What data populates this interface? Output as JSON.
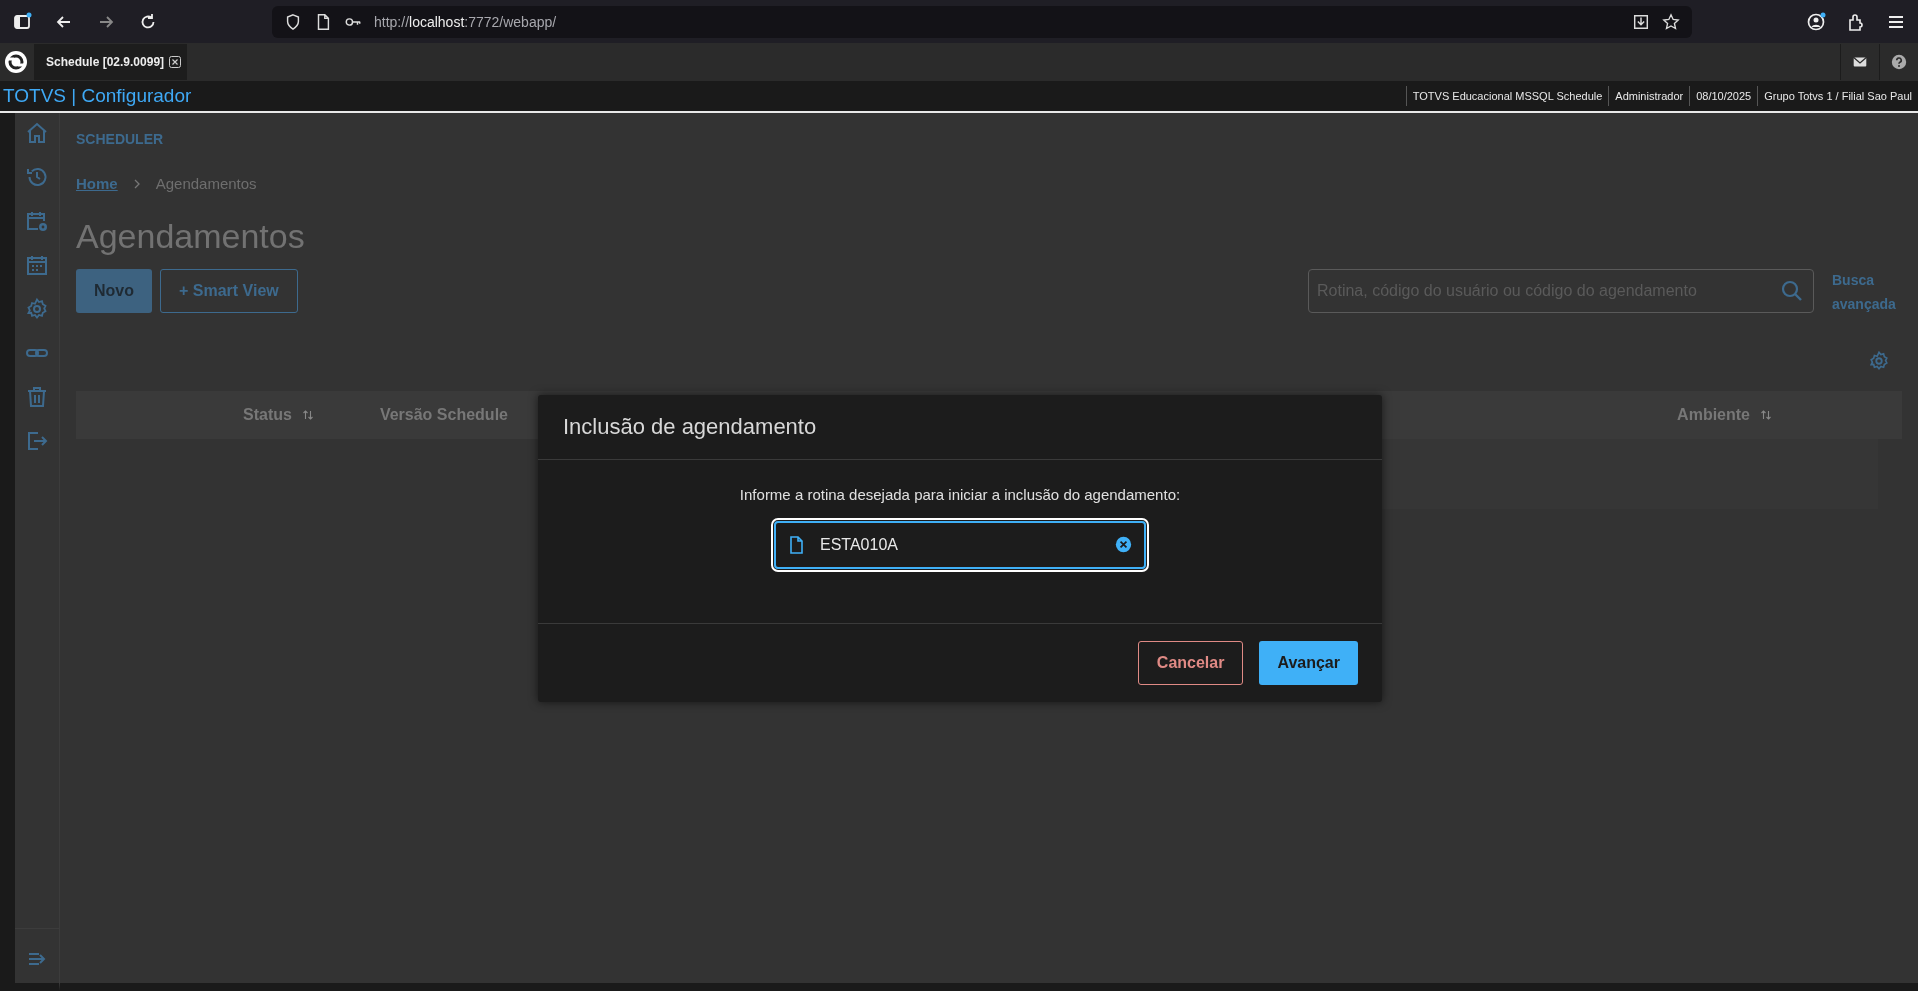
{
  "browser": {
    "url": "http://**localhost**:7772/webapp/"
  },
  "tab": {
    "title": "Schedule [02.9.0099]"
  },
  "app_header": {
    "title": "TOTVS | Configurador",
    "info": [
      "TOTVS Educacional MSSQL Schedule",
      "Administrador",
      "08/10/2025",
      "Grupo Totvs 1 / Filial Sao Paul"
    ]
  },
  "page": {
    "section": "SCHEDULER",
    "breadcrumb": [
      {
        "label": "Home",
        "kind": "link"
      },
      {
        "label": "Agendamentos",
        "kind": "current"
      }
    ],
    "title": "Agendamentos",
    "buttons": [
      {
        "label": "Novo",
        "kind": "primary"
      },
      {
        "label": "+ Smart View",
        "kind": "secondary"
      }
    ],
    "search": {
      "placeholder": "Rotina, código do usuário ou código do agendamento"
    },
    "advanced_search": "Busca avançada",
    "table": {
      "columns": [
        {
          "label": "Status",
          "sortable": true
        },
        {
          "label": "Versão Schedule",
          "sortable": false
        },
        {
          "label": "Ambiente",
          "sortable": true
        }
      ]
    }
  },
  "modal": {
    "title": "Inclusão de agendamento",
    "prompt": "Informe a rotina desejada para iniciar a inclusão do agendamento:",
    "field": {
      "value": "ESTA010A"
    },
    "buttons": [
      {
        "label": "Cancelar",
        "kind": "cancel"
      },
      {
        "label": "Avançar",
        "kind": "primary"
      }
    ]
  }
}
